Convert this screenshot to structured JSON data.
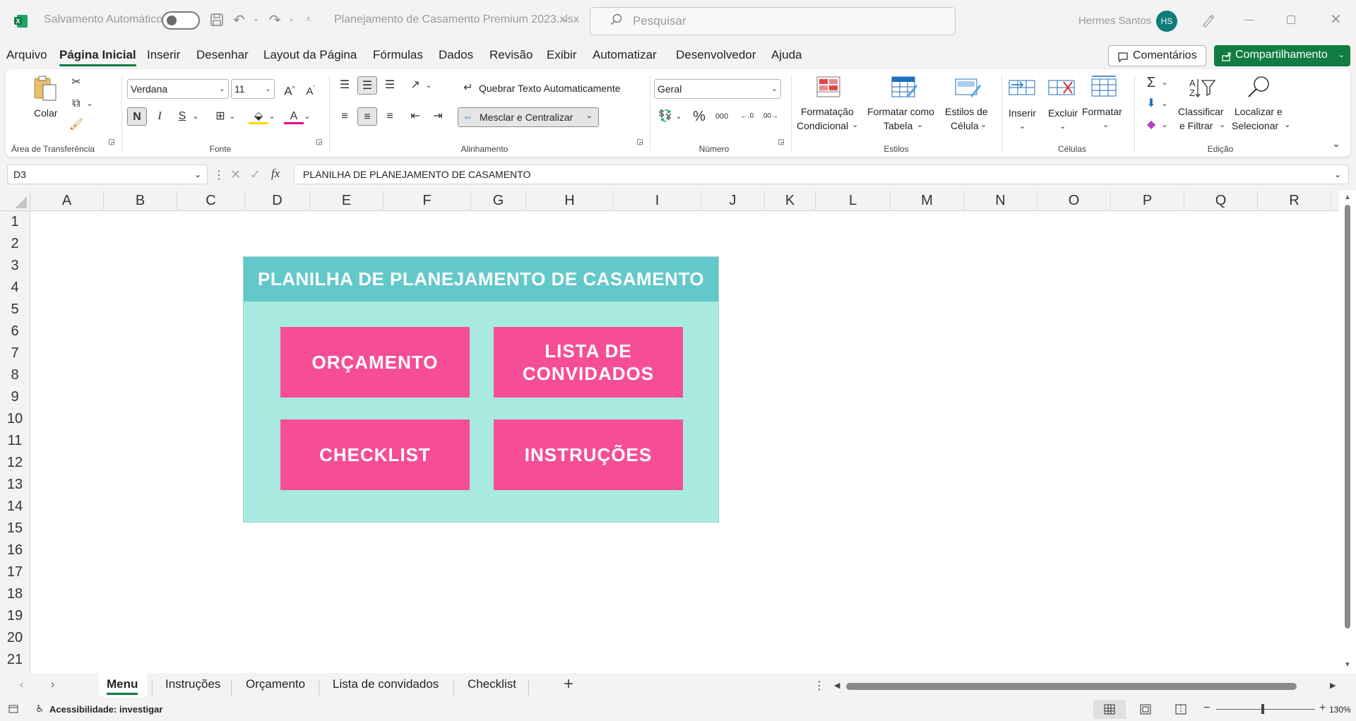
{
  "titlebar": {
    "autosave_label": "Salvamento Automático",
    "filename": "Planejamento de Casamento Premium 2023.xlsx",
    "search_placeholder": "Pesquisar",
    "user_name": "Hermes Santos",
    "user_initials": "HS"
  },
  "menu_tabs": [
    "Arquivo",
    "Página Inicial",
    "Inserir",
    "Desenhar",
    "Layout da Página",
    "Fórmulas",
    "Dados",
    "Revisão",
    "Exibir",
    "Automatizar",
    "Desenvolvedor",
    "Ajuda"
  ],
  "menu_active": "Página Inicial",
  "comments_label": "Comentários",
  "share_label": "Compartilhamento",
  "ribbon": {
    "clipboard": {
      "paste_label": "Colar",
      "group": "Área de Transferência"
    },
    "font": {
      "name": "Verdana",
      "size": "11",
      "bold": "N",
      "italic": "I",
      "underline": "S",
      "group": "Fonte"
    },
    "alignment": {
      "wrap_label": "Quebrar Texto Automaticamente",
      "merge_label": "Mesclar e Centralizar",
      "group": "Alinhamento"
    },
    "number": {
      "format": "Geral",
      "group": "Número"
    },
    "styles": {
      "cond_format": [
        "Formatação",
        "Condicional"
      ],
      "format_table": [
        "Formatar como",
        "Tabela"
      ],
      "cell_styles": [
        "Estilos de",
        "Célula"
      ],
      "group": "Estilos"
    },
    "cells": {
      "insert": "Inserir",
      "delete": "Excluir",
      "format": "Formatar",
      "group": "Células"
    },
    "editing": {
      "sort_filter": [
        "Classificar",
        "e Filtrar"
      ],
      "find_select": [
        "Localizar e",
        "Selecionar"
      ],
      "group": "Edição"
    }
  },
  "formula_bar": {
    "name_box": "D3",
    "formula": "PLANILHA DE PLANEJAMENTO DE CASAMENTO"
  },
  "columns": [
    "A",
    "B",
    "C",
    "D",
    "E",
    "F",
    "G",
    "H",
    "I",
    "J",
    "K",
    "L",
    "M",
    "N",
    "O",
    "P",
    "Q",
    "R"
  ],
  "rows": [
    "1",
    "2",
    "3",
    "4",
    "5",
    "6",
    "7",
    "8",
    "9",
    "10",
    "11",
    "12",
    "13",
    "14",
    "15",
    "16",
    "17",
    "18",
    "19",
    "20",
    "21"
  ],
  "panel": {
    "title": "PLANILHA DE PLANEJAMENTO DE CASAMENTO",
    "buttons": {
      "orcamento": "ORÇAMENTO",
      "lista_1": "LISTA DE",
      "lista_2": "CONVIDADOS",
      "checklist": "CHECKLIST",
      "instrucoes": "INSTRUÇÕES"
    }
  },
  "sheet_tabs": [
    "Menu",
    "Instruções",
    "Orçamento",
    "Lista de convidados",
    "Checklist"
  ],
  "sheet_active": "Menu",
  "status": {
    "accessibility": "Acessibilidade: investigar",
    "zoom": "130%"
  },
  "colors": {
    "excel_green": "#107c41",
    "panel_bg": "#a8eadf",
    "panel_title": "#63c8c9",
    "button_pink": "#f64e96"
  }
}
